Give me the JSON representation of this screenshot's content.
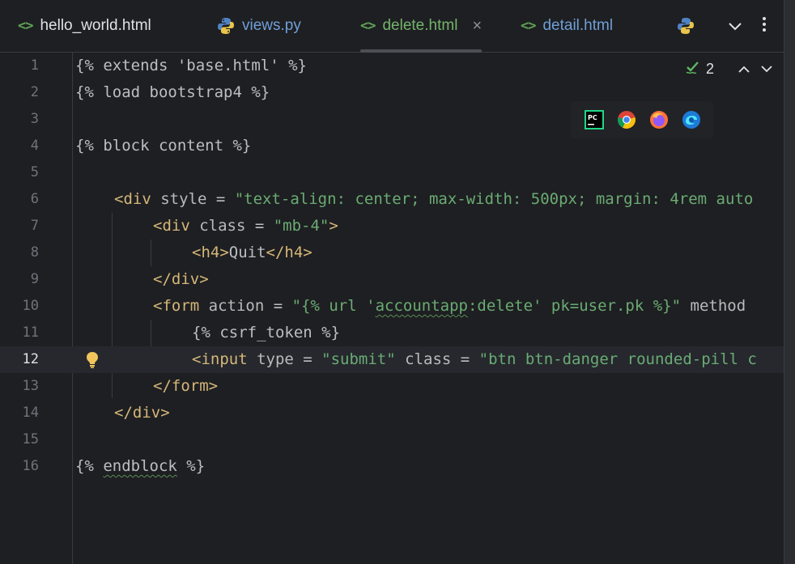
{
  "tabs": [
    {
      "label": "hello_world.html",
      "icon": "html-icon",
      "color": "white",
      "active": false
    },
    {
      "label": "views.py",
      "icon": "python-icon",
      "color": "blue",
      "active": false
    },
    {
      "label": "delete.html",
      "icon": "html-icon",
      "color": "green",
      "active": true
    },
    {
      "label": "detail.html",
      "icon": "html-icon",
      "color": "blue",
      "active": false
    }
  ],
  "html_icon_glyph": "<>",
  "close_glyph": "×",
  "inspection": {
    "count": "2"
  },
  "browsers": [
    "pycharm-icon",
    "chrome-icon",
    "firefox-icon",
    "edge-icon"
  ],
  "pycharm_logo_text": "PC",
  "line_numbers": [
    "1",
    "2",
    "3",
    "4",
    "5",
    "6",
    "7",
    "8",
    "9",
    "10",
    "11",
    "12",
    "13",
    "14",
    "15",
    "16"
  ],
  "current_line": "12",
  "code": {
    "l1": "{% extends 'base.html' %}",
    "l2": "{% load bootstrap4 %}",
    "l4": "{% block content %}",
    "l6": {
      "open": "<div",
      "attr": " style",
      "eq": " = ",
      "val": "\"text-align: center; max-width: 500px; margin: 4rem auto"
    },
    "l7": {
      "open": "<div",
      "attr": " class",
      "eq": " = ",
      "val": "\"mb-4\"",
      "close": ">"
    },
    "l8": {
      "open": "<h4>",
      "text": "Quit",
      "close": "</h4>"
    },
    "l9": "</div>",
    "l10": {
      "open": "<form",
      "attr": " action",
      "eq": " = ",
      "val1": "\"{% url '",
      "val2": "accountapp",
      "val3": ":delete' pk=user.pk %}\"",
      "attr2": " method"
    },
    "l11": "{% csrf_token %}",
    "l12": {
      "open": "<input",
      "attr": " type",
      "eq": " = ",
      "val": "\"submit\"",
      "attr2": " class",
      "eq2": " = ",
      "val2": "\"btn btn-danger rounded-pill c"
    },
    "l13": "</form>",
    "l14": "</div>",
    "l16": {
      "pre": "{% ",
      "kw": "endblock",
      "post": " %}"
    }
  },
  "colors": {
    "tag": "#d5b778",
    "string": "#6aab73",
    "text": "#bcbec4",
    "background": "#1e1f22"
  }
}
